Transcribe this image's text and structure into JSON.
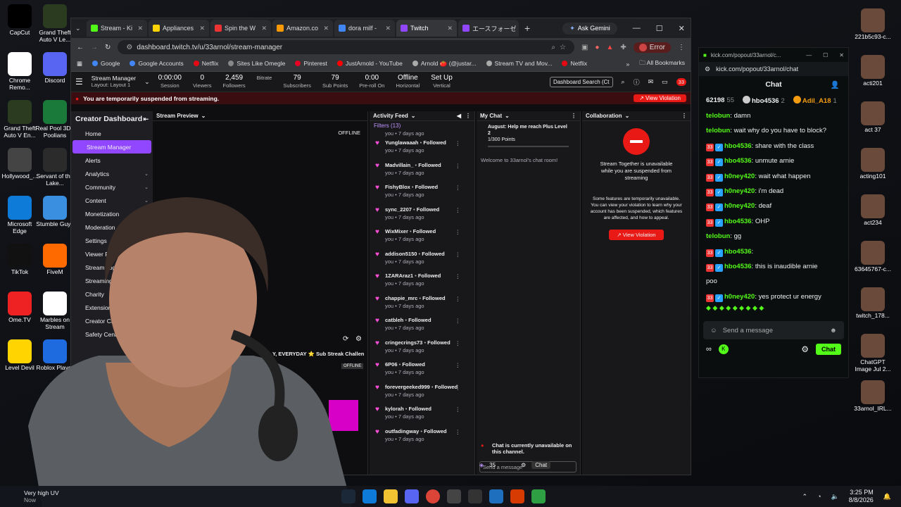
{
  "desktop": {
    "icons_left": [
      {
        "label": "CapCut",
        "color": "#000"
      },
      {
        "label": "Grand Theft Auto V Le...",
        "color": "#2a3b1f"
      },
      {
        "label": "Chrome Remo...",
        "color": "#ffffff"
      },
      {
        "label": "Discord",
        "color": "#5865f2"
      },
      {
        "label": "Grand Theft Auto V En...",
        "color": "#2a3b1f"
      },
      {
        "label": "Real Pool 3D - Poolians",
        "color": "#1a7a3a"
      },
      {
        "label": "Hollywood_...",
        "color": "#444"
      },
      {
        "label": "Servant of the Lake...",
        "color": "#2b2b2b"
      },
      {
        "label": "Microsoft Edge",
        "color": "#0f7bd8"
      },
      {
        "label": "Stumble Guys",
        "color": "#3a8fe0"
      },
      {
        "label": "TikTok",
        "color": "#111"
      },
      {
        "label": "FiveM",
        "color": "#ff6a00"
      },
      {
        "label": "Ome.TV",
        "color": "#e22"
      },
      {
        "label": "Marbles on Stream",
        "color": "#fff"
      },
      {
        "label": "Level Devil",
        "color": "#ffd400"
      },
      {
        "label": "Roblox Player",
        "color": "#1e6be0"
      }
    ],
    "icons_right": [
      {
        "label": "221b5c93-c..."
      },
      {
        "label": "acti201"
      },
      {
        "label": "act 37"
      },
      {
        "label": "acting101"
      },
      {
        "label": "act234"
      },
      {
        "label": "63645767-c..."
      },
      {
        "label": "twitch_178..."
      },
      {
        "label": "ChatGPT Image Jul 2..."
      },
      {
        "label": "33arnol_IRL..."
      }
    ]
  },
  "browser": {
    "tabs": [
      {
        "label": "Stream - Ki",
        "color": "#53fc18"
      },
      {
        "label": "Appliances",
        "color": "#ffd400"
      },
      {
        "label": "Spin the W",
        "color": "#e33"
      },
      {
        "label": "Amazon.co",
        "color": "#ff9900"
      },
      {
        "label": "dora milf -",
        "color": "#4285f4"
      },
      {
        "label": "Twitch",
        "color": "#9146ff"
      },
      {
        "label": "エースフォーゼ",
        "color": "#9146ff"
      }
    ],
    "ask_gemini": "Ask Gemini",
    "url": "dashboard.twitch.tv/u/33arnol/stream-manager",
    "error": "Error",
    "bookmarks": [
      "Google",
      "Google Accounts",
      "Netflix",
      "Sites Like Omegle",
      "Pinterest",
      "JustArnold - YouTube",
      "Arnold 🍅 (@justar...",
      "Stream TV and Mov...",
      "Netflix"
    ],
    "all_bookmarks": "All Bookmarks"
  },
  "twitch": {
    "layout_title": "Stream Manager",
    "layout_sub": "Layout: Layout 1",
    "stats": [
      {
        "v": "0:00:00",
        "l": "Session"
      },
      {
        "v": "0",
        "l": "Viewers"
      },
      {
        "v": "2,459",
        "l": "Followers"
      },
      {
        "v": "",
        "l": "Bitrate"
      },
      {
        "v": "79",
        "l": "Subscribers"
      },
      {
        "v": "79",
        "l": "Sub Points"
      },
      {
        "v": "0:00",
        "l": "Pre-roll On"
      },
      {
        "v": "Offline",
        "l": "Horizontal"
      },
      {
        "v": "Set Up",
        "l": "Vertical"
      }
    ],
    "search": "Dashboard Search (Ct",
    "notif": "33",
    "banner": "You are temporarily suspended from streaming.",
    "view_violation": "View Violation",
    "creator_dashboard": "Creator Dashboard",
    "nav": [
      {
        "l": "Home"
      },
      {
        "l": "Stream Manager"
      },
      {
        "l": "Alerts"
      },
      {
        "l": "Analytics"
      },
      {
        "l": "Community"
      },
      {
        "l": "Content"
      },
      {
        "l": "Monetization"
      },
      {
        "l": "Moderation"
      },
      {
        "l": "Settings"
      },
      {
        "l": "Viewer Rewards"
      },
      {
        "l": "Stream Together"
      },
      {
        "l": "Streaming Tools"
      },
      {
        "l": "Charity"
      },
      {
        "l": "Extensions"
      },
      {
        "l": "Creator Camp"
      },
      {
        "l": "Safety Center"
      }
    ],
    "stream_preview": "Stream Preview",
    "offline": "OFFLINE",
    "ticker": "Y, EVERYDAY ⭐ Sub Streak Challen",
    "activity_feed": "Activity Feed",
    "filters": "Filters (13)",
    "first_line": "you • 7 days ago",
    "feed": [
      {
        "n": "Yunglawaaah",
        "a": "Followed",
        "t": "you • 7 days ago"
      },
      {
        "n": "Madvillain_",
        "a": "Followed",
        "t": "you • 7 days ago"
      },
      {
        "n": "FishyBlox",
        "a": "Followed",
        "t": "you • 7 days ago"
      },
      {
        "n": "sync_2207",
        "a": "Followed",
        "t": "you • 7 days ago"
      },
      {
        "n": "WixMixer",
        "a": "Followed",
        "t": "you • 7 days ago"
      },
      {
        "n": "addison5150",
        "a": "Followed",
        "t": "you • 7 days ago"
      },
      {
        "n": "1ZARAraz1",
        "a": "Followed",
        "t": "you • 7 days ago"
      },
      {
        "n": "chappie_mrc",
        "a": "Followed",
        "t": "you • 7 days ago"
      },
      {
        "n": "catbleh",
        "a": "Followed",
        "t": "you • 7 days ago"
      },
      {
        "n": "cringecrings73",
        "a": "Followed",
        "t": "you • 7 days ago"
      },
      {
        "n": "6P06",
        "a": "Followed",
        "t": "you • 7 days ago"
      },
      {
        "n": "forevergeeked999",
        "a": "Followed",
        "t": "you • 7 days ago"
      },
      {
        "n": "kylorah",
        "a": "Followed",
        "t": "you • 7 days ago"
      },
      {
        "n": "outfadingway",
        "a": "Followed",
        "t": "you • 7 days ago"
      }
    ],
    "my_chat": "My Chat",
    "goal": "August: Help me reach Plus Level 2",
    "goal_points": "1/300 Points",
    "welcome": "Welcome to 33arnol's chat room!",
    "chat_unavail": "Chat is currently unavailable on this channel.",
    "send_placeholder": "Send a message",
    "points": "35",
    "chat_btn": "Chat",
    "collaboration": "Collaboration",
    "st_unavail": "Stream Together is unavailable while you are suspended from streaming",
    "st_info": "Some features are temporarily unavailable. You can view your violation to learn why your account has been suspended, which features are affected, and how to appeal.",
    "st_view": "View Violation"
  },
  "kick": {
    "url_title": "kick.com/popout/33arnol/c...",
    "url": "kick.com/popout/33arnol/chat",
    "title": "Chat",
    "top": [
      {
        "n": "62198",
        "c": "55"
      },
      {
        "n": "hbo4536",
        "c": "2"
      },
      {
        "n": "Adil_A18",
        "c": "1"
      }
    ],
    "messages": [
      {
        "u": "telobun",
        "m": "damn",
        "c": "#53fc18",
        "b": false
      },
      {
        "u": "telobun",
        "m": "wait why do you have to block?",
        "c": "#53fc18",
        "b": false
      },
      {
        "u": "hbo4536",
        "m": "share with the class",
        "c": "#53fc18",
        "b": true
      },
      {
        "u": "hbo4536",
        "m": "unmute arnie",
        "c": "#53fc18",
        "b": true
      },
      {
        "u": "h0ney420",
        "m": "wait what happen",
        "c": "#53fc18",
        "b": true
      },
      {
        "u": "h0ney420",
        "m": "i'm dead",
        "c": "#53fc18",
        "b": true
      },
      {
        "u": "h0ney420",
        "m": "deaf",
        "c": "#53fc18",
        "b": true
      },
      {
        "u": "hbo4536",
        "m": "OHP",
        "c": "#53fc18",
        "b": true
      },
      {
        "u": "telobun",
        "m": "gg",
        "c": "#53fc18",
        "b": false
      },
      {
        "u": "hbo4536",
        "m": "",
        "c": "#53fc18",
        "b": true
      },
      {
        "u": "hbo4536",
        "m": "this is inaudible arnie",
        "c": "#53fc18",
        "b": true
      },
      {
        "u": "",
        "m": "poo",
        "c": "#fff",
        "b": false
      },
      {
        "u": "h0ney420",
        "m": "yes protect ur energy",
        "c": "#53fc18",
        "b": true
      }
    ],
    "placeholder": "Send a message",
    "chat_btn": "Chat"
  },
  "taskbar": {
    "weather": "Very high UV",
    "weather_sub": "Now",
    "time": "3:25 PM",
    "date": "8/8/2026"
  }
}
